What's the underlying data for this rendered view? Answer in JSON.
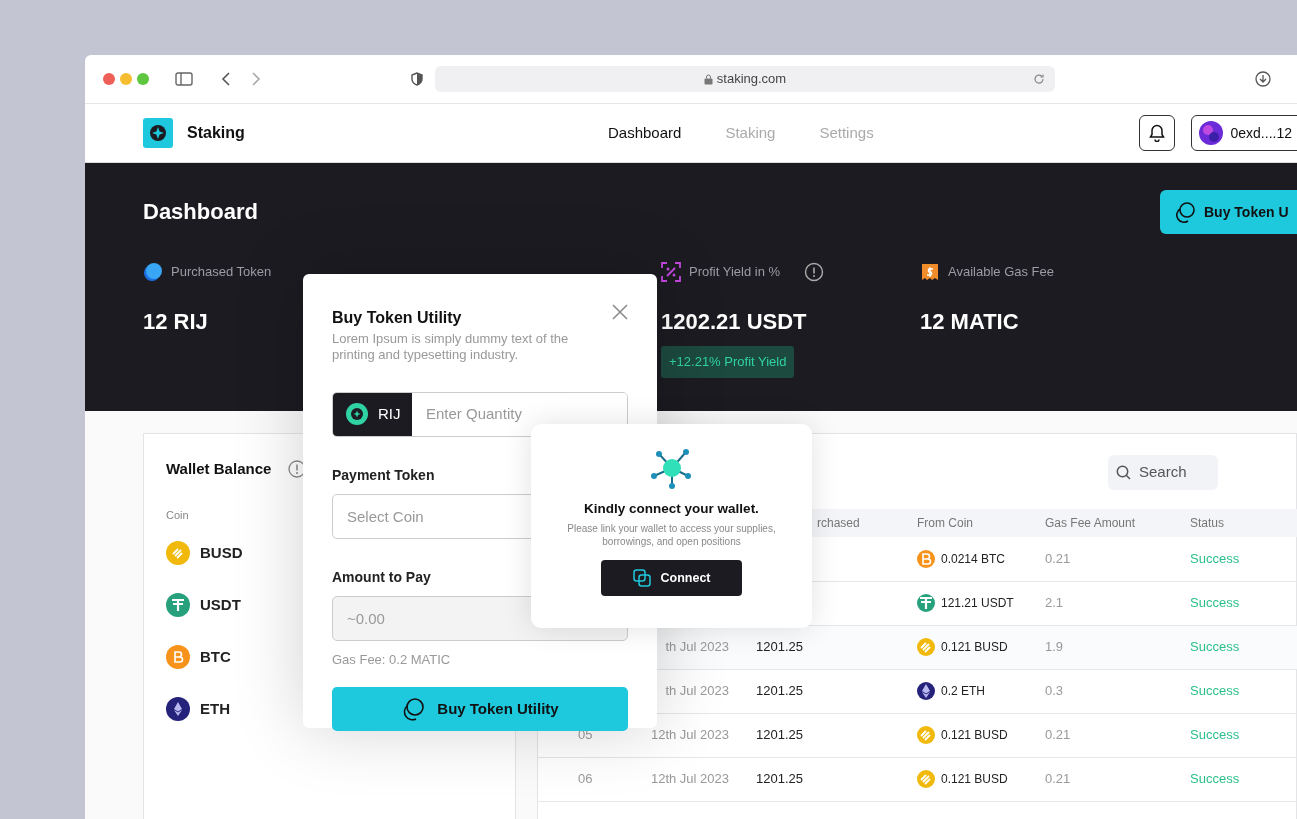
{
  "browser": {
    "url": "staking.com"
  },
  "app": {
    "name": "Staking"
  },
  "nav": [
    {
      "label": "Dashboard",
      "selected": true
    },
    {
      "label": "Staking",
      "selected": false
    },
    {
      "label": "Settings",
      "selected": false
    }
  ],
  "wallet_button": {
    "label": "0exd....12"
  },
  "hero": {
    "title": "Dashboard",
    "buy_button": "Buy Token U",
    "stats": [
      {
        "kind": "purchased",
        "label": "Purchased Token",
        "value": "12 RIJ"
      },
      {
        "kind": "profit",
        "label": "Profit Yield in %",
        "value": "1202.21 USDT",
        "badge": "+12.21% Profit Yield"
      },
      {
        "kind": "gas",
        "label": "Available Gas Fee",
        "value": "12 MATIC"
      }
    ]
  },
  "wallet": {
    "title": "Wallet Balance",
    "column": "Coin",
    "coins": [
      {
        "kind": "busd",
        "symbol": "BUSD"
      },
      {
        "kind": "usdt",
        "symbol": "USDT"
      },
      {
        "kind": "btc",
        "symbol": "BTC"
      },
      {
        "kind": "eth",
        "symbol": "ETH"
      }
    ]
  },
  "table": {
    "search_placeholder": "Search",
    "columns": {
      "column_3": "rchased",
      "from_coin": "From Coin",
      "gas_fee_amount": "Gas Fee Amount",
      "status": "Status"
    },
    "rows": [
      {
        "from_coin": {
          "kind": "btc",
          "text": "0.0214 BTC"
        },
        "gas_fee": "0.21",
        "status": "Success"
      },
      {
        "from_coin": {
          "kind": "usdt",
          "text": "121.21 USDT"
        },
        "gas_fee": "2.1",
        "status": "Success"
      },
      {
        "date": "th Jul 2023",
        "purchased": "1201.25",
        "from_coin": {
          "kind": "busd",
          "text": "0.121 BUSD"
        },
        "gas_fee": "1.9",
        "status": "Success"
      },
      {
        "date": "th Jul 2023",
        "purchased": "1201.25",
        "from_coin": {
          "kind": "eth",
          "text": "0.2 ETH"
        },
        "gas_fee": "0.3",
        "status": "Success"
      },
      {
        "number": "05",
        "date": "12th Jul 2023",
        "purchased": "1201.25",
        "from_coin": {
          "kind": "busd",
          "text": "0.121 BUSD"
        },
        "gas_fee": "0.21",
        "status": "Success"
      },
      {
        "number": "06",
        "date": "12th Jul 2023",
        "purchased": "1201.25",
        "from_coin": {
          "kind": "busd",
          "text": "0.121 BUSD"
        },
        "gas_fee": "0.21",
        "status": "Success"
      }
    ]
  },
  "modal": {
    "title": "Buy Token Utility",
    "subtitle": "Lorem Ipsum is simply dummy text of the printing and typesetting industry.",
    "token": "RIJ",
    "quantity_placeholder": "Enter Quantity",
    "payment_label": "Payment Token",
    "payment_placeholder": "Select Coin",
    "amount_label": "Amount to Pay",
    "amount_placeholder": "~0.00",
    "gas_fee": "Gas Fee: 0.2 MATIC",
    "button": "Buy Token Utility"
  },
  "connect_popup": {
    "title": "Kindly connect your wallet.",
    "text": "Please link your wallet to access your supplies, borrowings, and open positions",
    "button": "Connect"
  }
}
